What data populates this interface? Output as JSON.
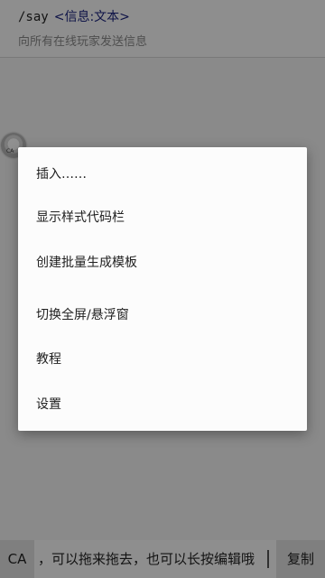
{
  "suggestion": {
    "command": "/say",
    "param": "<信息:文本>",
    "description": "向所有在线玩家发送信息"
  },
  "float_ball": {
    "label": "CA"
  },
  "menu": {
    "items": [
      {
        "label": "插入……"
      },
      {
        "label": "显示样式代码栏"
      },
      {
        "label": "创建批量生成模板"
      },
      {
        "label": "切换全屏/悬浮窗"
      },
      {
        "label": "教程"
      },
      {
        "label": "设置"
      }
    ]
  },
  "input_bar": {
    "prefix": "CA",
    "text": "，可以拖来拖去，也可以长按编辑哦",
    "copy_label": "复制"
  }
}
